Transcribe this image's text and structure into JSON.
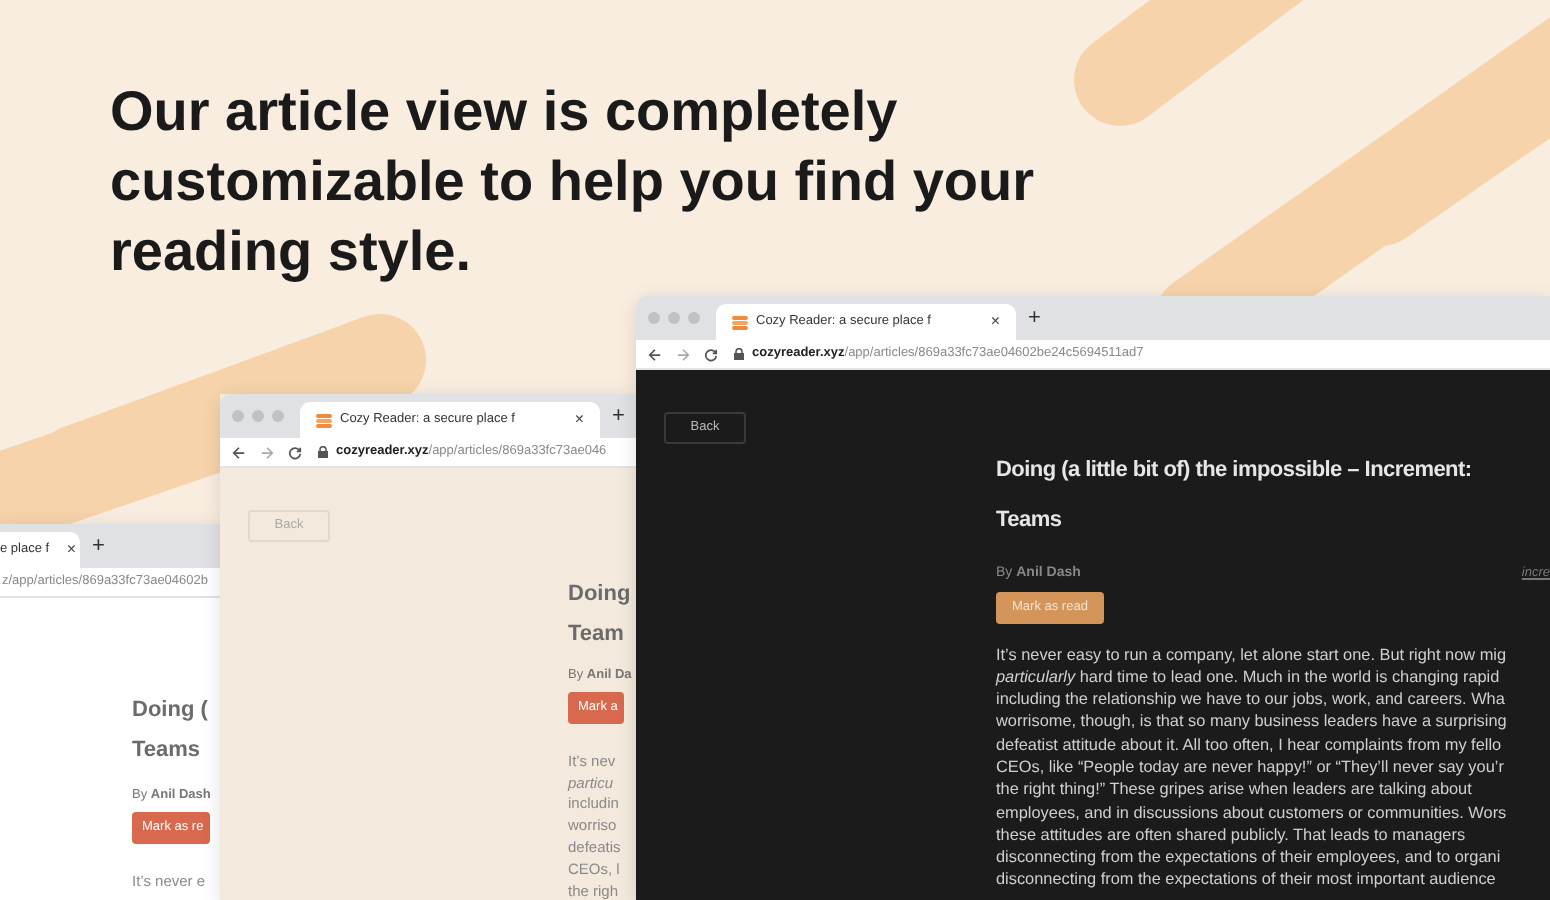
{
  "headline": "Our article view is completely customizable to help you find your reading style.",
  "windows": [
    {
      "kind": "light",
      "tab_title": "e place f",
      "tab_close": "×",
      "new_tab": "+",
      "url_path": "z/app/articles/869a33fc73ae04602b",
      "title_lines": [
        "Doing (",
        "Teams"
      ],
      "byline": "By **Anil Dash**",
      "mark_button": "Mark as re",
      "paragraph_lines": [
        "It’s never e"
      ]
    },
    {
      "kind": "sepia",
      "tab_title": "Cozy Reader: a secure place f",
      "tab_close": "×",
      "new_tab": "+",
      "url_host": "cozyreader.xyz",
      "url_path": "/app/articles/869a33fc73ae046",
      "back": "Back",
      "title_lines": [
        "Doing",
        "Team"
      ],
      "byline": "By **Anil Da**",
      "mark_button": "Mark a",
      "paragraph_lines": [
        "It’s nev",
        "*particu*",
        "includin",
        "worriso",
        "defeatis",
        "CEOs, l",
        "the righ"
      ]
    },
    {
      "kind": "dark",
      "tab_title": "Cozy Reader: a secure place f",
      "tab_close": "×",
      "new_tab": "+",
      "url_host": "cozyreader.xyz",
      "url_path": "/app/articles/869a33fc73ae04602be24c5694511ad7",
      "back": "Back",
      "title_lines": [
        "Doing (a little bit of) the impossible – Increment:",
        "Teams"
      ],
      "byline": "By **Anil Dash**",
      "source_link": "incre",
      "mark_button": "Mark as read",
      "paragraph_lines": [
        "It’s never easy to run a company, let alone start one. But right now mig",
        "*particularly* hard time to lead one. Much in the world is changing rapid",
        "including the relationship we have to our jobs, work, and careers. Wha",
        "worrisome, though, is that so many business leaders have a surprising",
        "defeatist attitude about it. All too often, I hear complaints from my fello",
        "CEOs, like “People today are never happy!” or “They’ll never say you’r",
        "the right thing!” These gripes arise when leaders are talking about",
        "employees, and in discussions about customers or communities. Wors",
        "these attitudes are often shared publicly. That leads to managers",
        "disconnecting from the expectations of their employees, and to organi",
        "disconnecting from the expectations of their most important audience"
      ]
    }
  ]
}
